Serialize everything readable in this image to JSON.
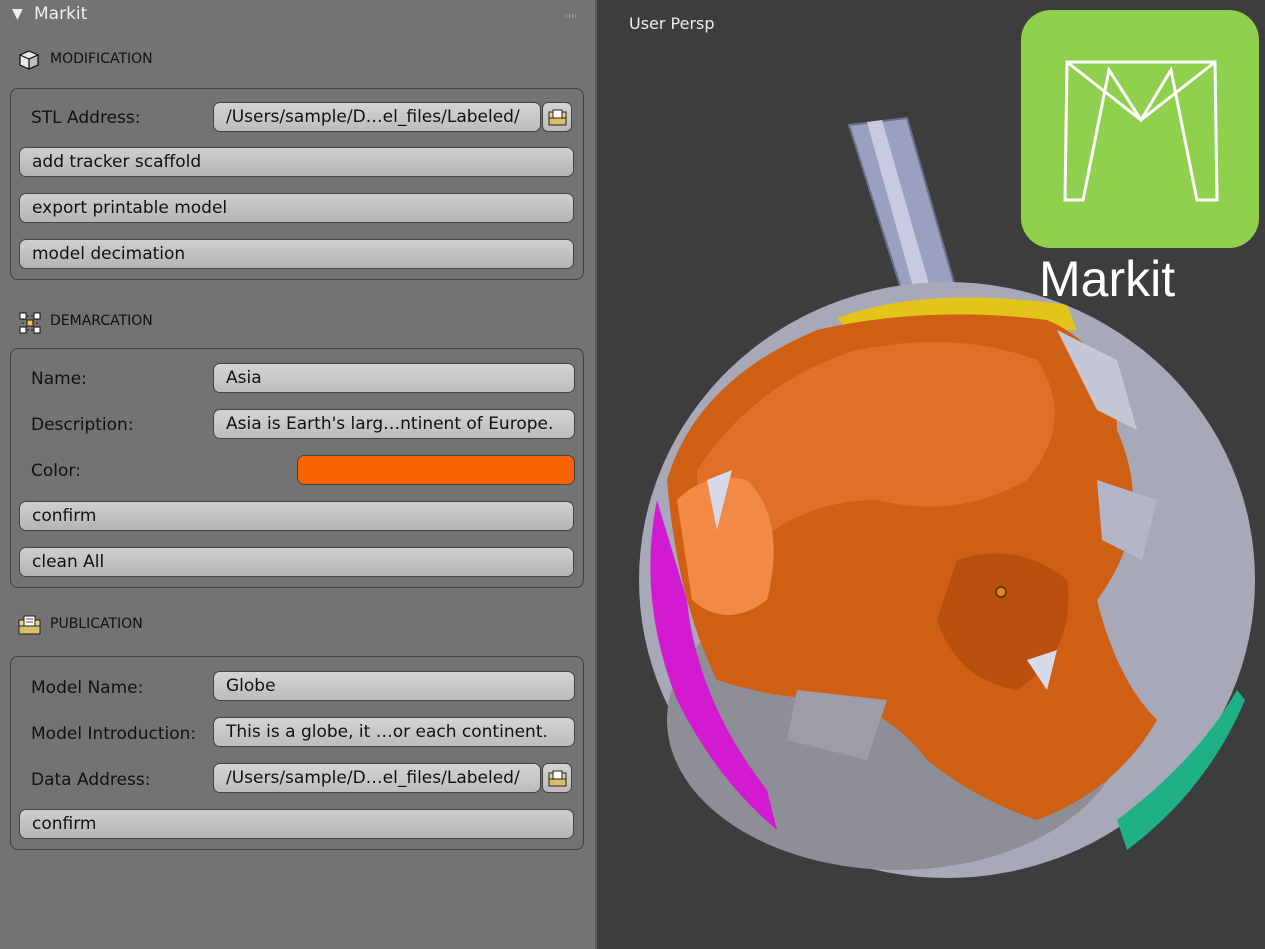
{
  "panel": {
    "title": "Markit"
  },
  "modification": {
    "section_title": "MODIFICATION",
    "stl_label": "STL Address:",
    "stl_value": "/Users/sample/D…el_files/Labeled/",
    "add_scaffold": "add tracker scaffold",
    "export_model": "export printable model",
    "decimation": "model decimation"
  },
  "demarcation": {
    "section_title": "DEMARCATION",
    "name_label": "Name:",
    "name_value": "Asia",
    "description_label": "Description:",
    "description_value": "Asia is Earth's larg…ntinent of Europe.",
    "color_label": "Color:",
    "color_value": "#f96200",
    "confirm": "confirm",
    "clean_all": "clean All"
  },
  "publication": {
    "section_title": "PUBLICATION",
    "model_name_label": "Model Name:",
    "model_name_value": "Globe",
    "intro_label": "Model Introduction:",
    "intro_value": "This is a globe, it …or each continent.",
    "data_address_label": "Data Address:",
    "data_address_value": "/Users/sample/D…el_files/Labeled/",
    "confirm": "confirm"
  },
  "viewport": {
    "view_label": "User Persp",
    "logo_text": "Markit",
    "logo_color": "#8fd14f"
  },
  "icons": [
    "triangle-down-icon",
    "cube-icon",
    "vertex-select-icon",
    "folder-icon",
    "file-browse-icon"
  ]
}
